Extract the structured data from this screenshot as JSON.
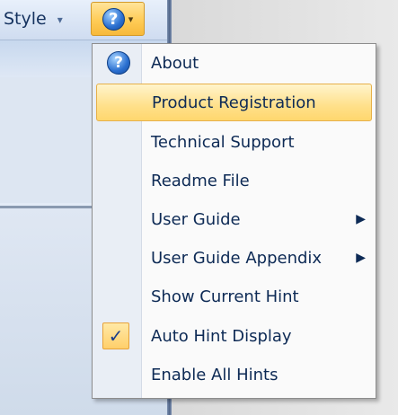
{
  "toolbar": {
    "style_label": "Style",
    "style_chevron": "▾",
    "help_chevron": "▾",
    "help_icon_glyph": "?"
  },
  "menu": {
    "items": [
      {
        "label": "About",
        "icon": "help-icon"
      },
      {
        "label": "Product Registration",
        "highlighted": true
      },
      {
        "label": "Technical Support"
      },
      {
        "label": "Readme File"
      },
      {
        "label": "User Guide",
        "submenu": true
      },
      {
        "label": "User Guide Appendix",
        "submenu": true
      },
      {
        "label": "Show Current Hint"
      },
      {
        "label": "Auto Hint Display",
        "checked": true
      },
      {
        "label": "Enable All Hints"
      }
    ],
    "submenu_arrow": "▶",
    "check_glyph": "✓"
  },
  "colors": {
    "highlight": "#ffe08a",
    "menu_text": "#0d2a55",
    "accent_blue": "#2a6fd0"
  }
}
